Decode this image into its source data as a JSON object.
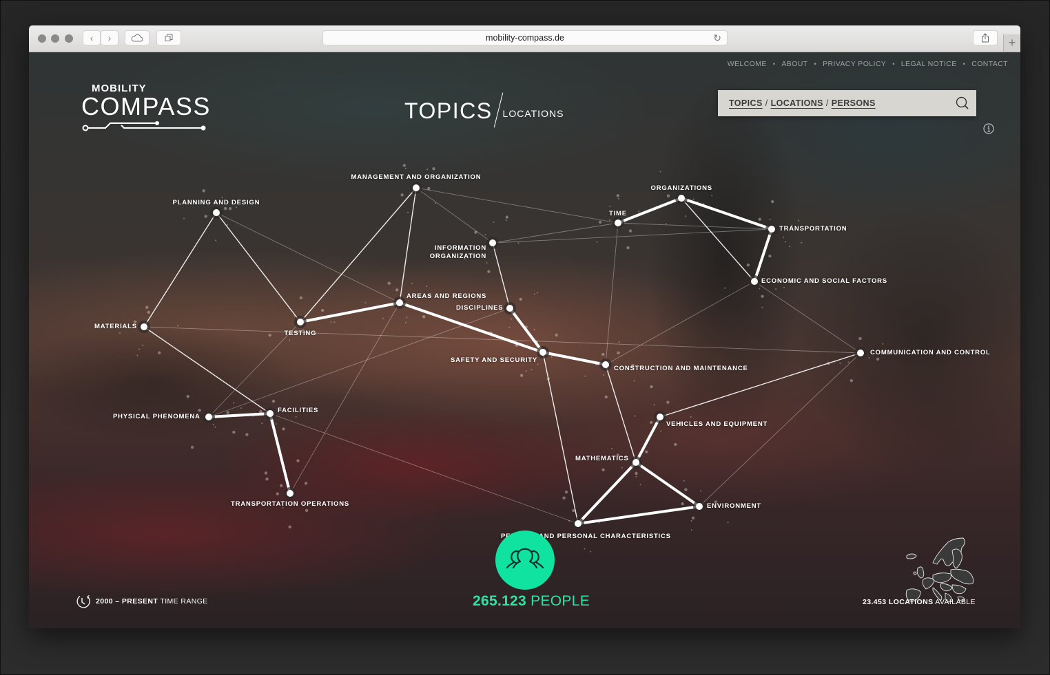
{
  "browser": {
    "url": "mobility-compass.de",
    "buttons": {
      "back": "‹",
      "forward": "›",
      "new_tab": "+"
    }
  },
  "nav": {
    "items": [
      "WELCOME",
      "ABOUT",
      "PRIVACY POLICY",
      "LEGAL NOTICE",
      "CONTACT"
    ],
    "separator": "•"
  },
  "logo": {
    "line1": "MOBILITY",
    "line2": "COMPASS"
  },
  "mode": {
    "primary": "TOPICS",
    "secondary": "LOCATIONS"
  },
  "search": {
    "links": [
      "TOPICS",
      "LOCATIONS",
      "PERSONS"
    ],
    "separator": "/"
  },
  "graph": {
    "nodes": [
      {
        "id": "planning",
        "label": "PLANNING AND DESIGN"
      },
      {
        "id": "management",
        "label": "MANAGEMENT AND ORGANIZATION"
      },
      {
        "id": "organizations",
        "label": "ORGANIZATIONS"
      },
      {
        "id": "time",
        "label": "TIME"
      },
      {
        "id": "transportation",
        "label": "TRANSPORTATION"
      },
      {
        "id": "infoorg",
        "label": "INFORMATION ORGANIZATION"
      },
      {
        "id": "economic",
        "label": "ECONOMIC AND SOCIAL FACTORS"
      },
      {
        "id": "areas",
        "label": "AREAS AND REGIONS"
      },
      {
        "id": "disciplines",
        "label": "DISCIPLINES"
      },
      {
        "id": "materials",
        "label": "MATERIALS"
      },
      {
        "id": "testing",
        "label": "TESTING"
      },
      {
        "id": "safety",
        "label": "SAFETY AND SECURITY"
      },
      {
        "id": "construction",
        "label": "CONSTRUCTION AND MAINTENANCE"
      },
      {
        "id": "communication",
        "label": "COMMUNICATION AND CONTROL"
      },
      {
        "id": "physical",
        "label": "PHYSICAL PHENOMENA"
      },
      {
        "id": "facilities",
        "label": "FACILITIES"
      },
      {
        "id": "vehicles",
        "label": "VEHICLES AND EQUIPMENT"
      },
      {
        "id": "mathematics",
        "label": "MATHEMATICS"
      },
      {
        "id": "transops",
        "label": "TRANSPORTATION OPERATIONS"
      },
      {
        "id": "environment",
        "label": "ENVIRONMENT"
      },
      {
        "id": "persons",
        "label": "PERSONS AND PERSONAL CHARACTERISTICS"
      }
    ],
    "strong_links": [
      [
        "organizations",
        "time"
      ],
      [
        "organizations",
        "transportation"
      ],
      [
        "transportation",
        "economic"
      ],
      [
        "testing",
        "areas"
      ],
      [
        "areas",
        "safety"
      ],
      [
        "disciplines",
        "safety"
      ],
      [
        "safety",
        "construction"
      ],
      [
        "physical",
        "facilities"
      ],
      [
        "facilities",
        "transops"
      ],
      [
        "mathematics",
        "vehicles"
      ],
      [
        "mathematics",
        "persons"
      ],
      [
        "mathematics",
        "environment"
      ],
      [
        "persons",
        "environment"
      ]
    ],
    "medium_links": [
      [
        "planning",
        "materials"
      ],
      [
        "planning",
        "testing"
      ],
      [
        "management",
        "testing"
      ],
      [
        "management",
        "areas"
      ],
      [
        "materials",
        "facilities"
      ],
      [
        "infoorg",
        "disciplines"
      ],
      [
        "organizations",
        "economic"
      ],
      [
        "construction",
        "mathematics"
      ],
      [
        "safety",
        "persons"
      ],
      [
        "vehicles",
        "communication"
      ]
    ],
    "weak_links": [
      [
        "management",
        "time"
      ],
      [
        "management",
        "infoorg"
      ],
      [
        "infoorg",
        "time"
      ],
      [
        "infoorg",
        "transportation"
      ],
      [
        "time",
        "transportation"
      ],
      [
        "time",
        "construction"
      ],
      [
        "economic",
        "construction"
      ],
      [
        "economic",
        "communication"
      ],
      [
        "planning",
        "areas"
      ],
      [
        "materials",
        "communication"
      ],
      [
        "areas",
        "transops"
      ],
      [
        "testing",
        "physical"
      ],
      [
        "communication",
        "environment"
      ],
      [
        "facilities",
        "persons"
      ],
      [
        "physical",
        "disciplines"
      ]
    ]
  },
  "people": {
    "count": "265.123",
    "label": "PEOPLE"
  },
  "time_range": {
    "range": "2000 – PRESENT",
    "label": "TIME RANGE"
  },
  "locations": {
    "count": "23.453 LOCATIONS",
    "label": "AVAILABLE"
  },
  "colors": {
    "accent": "#10e2a0",
    "accent_text": "#2fe3a8",
    "node": "#ffffff",
    "search_bg": "#d8d6d1"
  }
}
